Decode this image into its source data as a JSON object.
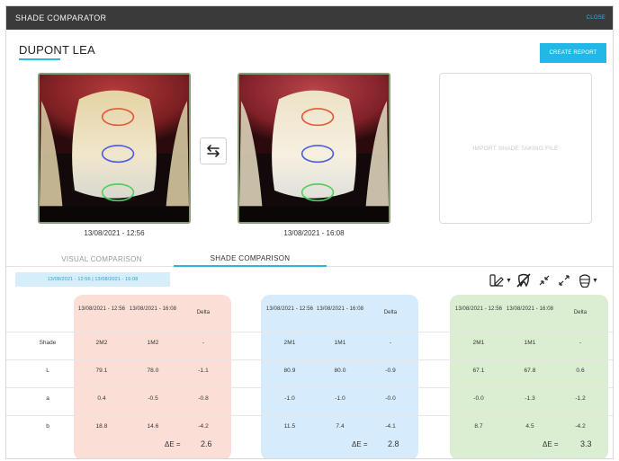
{
  "app": {
    "title": "SHADE COMPARATOR",
    "close_label": "CLOSE"
  },
  "patient": {
    "name": "DUPONT LEA"
  },
  "actions": {
    "create_report": "CREATE REPORT"
  },
  "photos": {
    "left_date": "13/08/2021 - 12:56",
    "right_date": "13/08/2021 - 16:08",
    "zone_colors": {
      "top": "#e8563a",
      "middle": "#4a5ee0",
      "bottom": "#4fd05e"
    }
  },
  "import": {
    "label": "IMPORT SHADE TAKING FILE"
  },
  "tabs": [
    {
      "label": "VISUAL COMPARISON",
      "active": false
    },
    {
      "label": "SHADE COMPARISON",
      "active": true
    }
  ],
  "date_chip": "13/08/2021 - 12:56 | 13/08/2021 - 16:08",
  "toolbar_icons": [
    "shade-guide-icon",
    "crossed-tooth-icon",
    "collapse-arrows-icon",
    "expand-arrows-icon",
    "tooth-zones-icon"
  ],
  "table": {
    "row_labels": [
      "Shade",
      "L",
      "a",
      "b"
    ],
    "delta_e_label": "ΔE =",
    "groups": [
      {
        "color": "#fbded5",
        "headers": [
          "13/08/2021 - 12:56",
          "13/08/2021 - 16:08",
          "Delta"
        ],
        "rows": [
          [
            "2M2",
            "1M2",
            "-"
          ],
          [
            "79.1",
            "78.0",
            "-1.1"
          ],
          [
            "0.4",
            "-0.5",
            "-0.8"
          ],
          [
            "18.8",
            "14.6",
            "-4.2"
          ]
        ],
        "delta_e": "2.6"
      },
      {
        "color": "#d6ebfb",
        "headers": [
          "13/08/2021 - 12:56",
          "13/08/2021 - 16:08",
          "Delta"
        ],
        "rows": [
          [
            "2M1",
            "1M1",
            "-"
          ],
          [
            "80.9",
            "80.0",
            "-0.9"
          ],
          [
            "-1.0",
            "-1.0",
            "-0.0"
          ],
          [
            "11.5",
            "7.4",
            "-4.1"
          ]
        ],
        "delta_e": "2.8"
      },
      {
        "color": "#dbeed1",
        "headers": [
          "13/08/2021 - 12:56",
          "13/08/2021 - 16:08",
          "Delta"
        ],
        "rows": [
          [
            "2M1",
            "1M1",
            "-"
          ],
          [
            "67.1",
            "67.8",
            "0.6"
          ],
          [
            "-0.0",
            "-1.3",
            "-1.2"
          ],
          [
            "8.7",
            "4.5",
            "-4.2"
          ]
        ],
        "delta_e": "3.3"
      }
    ]
  }
}
